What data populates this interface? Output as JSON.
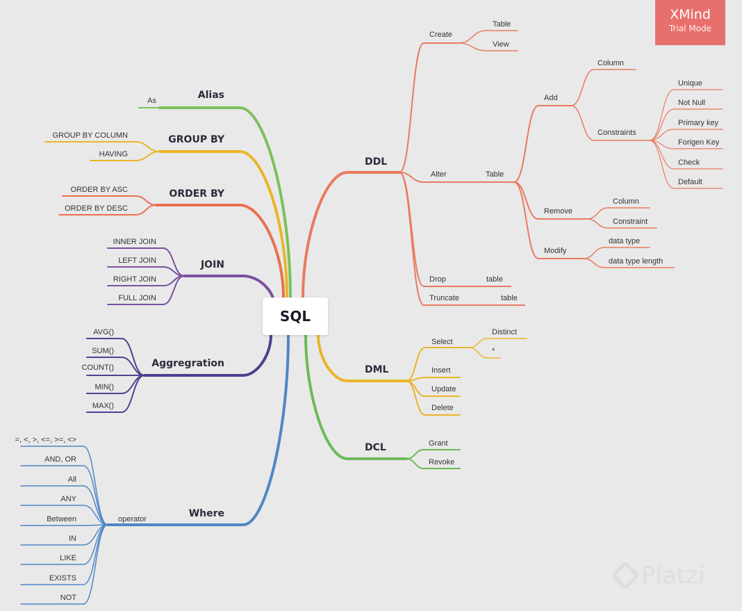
{
  "root": {
    "label": "SQL"
  },
  "badge": {
    "title": "XMind",
    "subtitle": "Trial Mode"
  },
  "watermark": {
    "text": "Platzi"
  },
  "colors": {
    "ddl": "#e87a5f",
    "dml": "#e9b528",
    "dcl": "#6cb95a",
    "alias": "#7cc05c",
    "groupby": "#e9b528",
    "orderby": "#e9704f",
    "join": "#7b4f9e",
    "aggregation": "#4f3f8f",
    "where": "#4f86c6"
  },
  "branches": {
    "ddl": {
      "title": "DDL",
      "create": {
        "label": "Create",
        "children": [
          "Table",
          "View"
        ]
      },
      "alter": {
        "label": "Alter",
        "table": "Table",
        "add": {
          "label": "Add",
          "column": "Column",
          "constraints": {
            "label": "Constraints",
            "children": [
              "Unique",
              "Not Null",
              "Primary key",
              "Forigen Key",
              "Check",
              "Default"
            ]
          }
        },
        "remove": {
          "label": "Remove",
          "children": [
            "Column",
            "Constraint"
          ]
        },
        "modify": {
          "label": "Modify",
          "children": [
            "data type",
            "data type length"
          ]
        }
      },
      "drop": {
        "label": "Drop",
        "child": "table"
      },
      "truncate": {
        "label": "Truncate",
        "child": "table"
      }
    },
    "dml": {
      "title": "DML",
      "select": {
        "label": "Select",
        "children": [
          "Distinct",
          "*"
        ]
      },
      "items": [
        "Insert",
        "Update",
        "Delete"
      ]
    },
    "dcl": {
      "title": "DCL",
      "items": [
        "Grant",
        "Revoke"
      ]
    },
    "alias": {
      "title": "Alias",
      "items": [
        "As"
      ]
    },
    "groupby": {
      "title": "GROUP BY",
      "items": [
        "GROUP BY COLUMN",
        "HAVING"
      ]
    },
    "orderby": {
      "title": "ORDER BY",
      "items": [
        "ORDER BY ASC",
        "ORDER BY DESC"
      ]
    },
    "join": {
      "title": "JOIN",
      "items": [
        "INNER JOIN",
        "LEFT JOIN",
        "RIGHT JOIN",
        "FULL JOIN"
      ]
    },
    "aggregation": {
      "title": "Aggregration",
      "items": [
        "AVG()",
        "SUM()",
        "COUNT()",
        "MIN()",
        "MAX()"
      ]
    },
    "where": {
      "title": "Where",
      "operator": "operator",
      "items": [
        "=, <, >, <=, >=, <>",
        "AND, OR",
        "All",
        "ANY",
        "Between",
        "IN",
        "LIKE",
        "EXISTS",
        "NOT"
      ]
    }
  }
}
